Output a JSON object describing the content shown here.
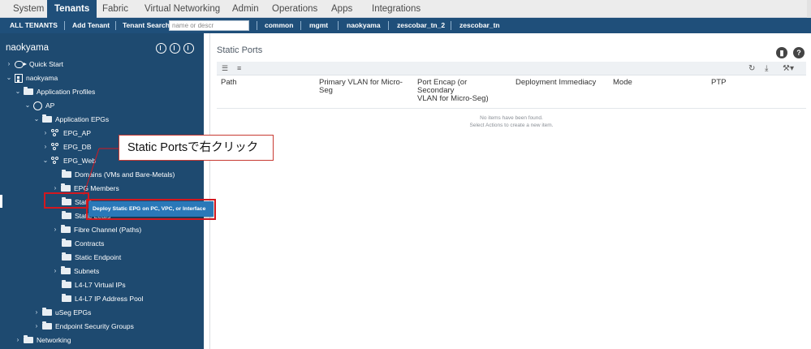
{
  "top_tabs": [
    {
      "label": "System"
    },
    {
      "label": "Tenants"
    },
    {
      "label": "Fabric"
    },
    {
      "label": "Virtual Networking"
    },
    {
      "label": "Admin"
    },
    {
      "label": "Operations"
    },
    {
      "label": "Apps"
    },
    {
      "label": "Integrations"
    }
  ],
  "subnav": {
    "all_tenants": "ALL TENANTS",
    "add_tenant": "Add Tenant",
    "tenant_search_label": "Tenant Search:",
    "search_placeholder": "name or descr",
    "tenants": [
      "common",
      "mgmt",
      "naokyama",
      "zescobar_tn_2",
      "zescobar_tn"
    ]
  },
  "sidebar": {
    "title": "naokyama",
    "tree": [
      {
        "label": "Quick Start"
      },
      {
        "label": "naokyama"
      },
      {
        "label": "Application Profiles"
      },
      {
        "label": "AP"
      },
      {
        "label": "Application EPGs"
      },
      {
        "label": "EPG_AP"
      },
      {
        "label": "EPG_DB"
      },
      {
        "label": "EPG_Web"
      },
      {
        "label": "Domains (VMs and Bare-Metals)"
      },
      {
        "label": "EPG Members"
      },
      {
        "label": "Static"
      },
      {
        "label": "Static Leafs"
      },
      {
        "label": "Fibre Channel (Paths)"
      },
      {
        "label": "Contracts"
      },
      {
        "label": "Static Endpoint"
      },
      {
        "label": "Subnets"
      },
      {
        "label": "L4-L7 Virtual IPs"
      },
      {
        "label": "L4-L7 IP Address Pool"
      },
      {
        "label": "uSeg EPGs"
      },
      {
        "label": "Endpoint Security Groups"
      },
      {
        "label": "Networking"
      }
    ]
  },
  "context_menu": {
    "item": "Deploy Static EPG on PC, VPC, or Interface"
  },
  "callout": {
    "text": "Static Portsで右クリック"
  },
  "main": {
    "title": "Static Ports",
    "columns": [
      {
        "label": "Path"
      },
      {
        "label": "Primary VLAN for Micro-\nSeg"
      },
      {
        "label": "Port Encap (or\nSecondary\nVLAN for Micro-Seg)"
      },
      {
        "label": "Deployment Immediacy"
      },
      {
        "label": "Mode"
      },
      {
        "label": "PTP"
      }
    ],
    "empty_line1": "No items have been found.",
    "empty_line2": "Select Actions to create a new item."
  },
  "colors": {
    "nav_blue": "#1f4f7a",
    "sidebar_blue": "#1e4a70",
    "menu_blue": "#2a78b8",
    "annotation_red": "#d3181f"
  }
}
